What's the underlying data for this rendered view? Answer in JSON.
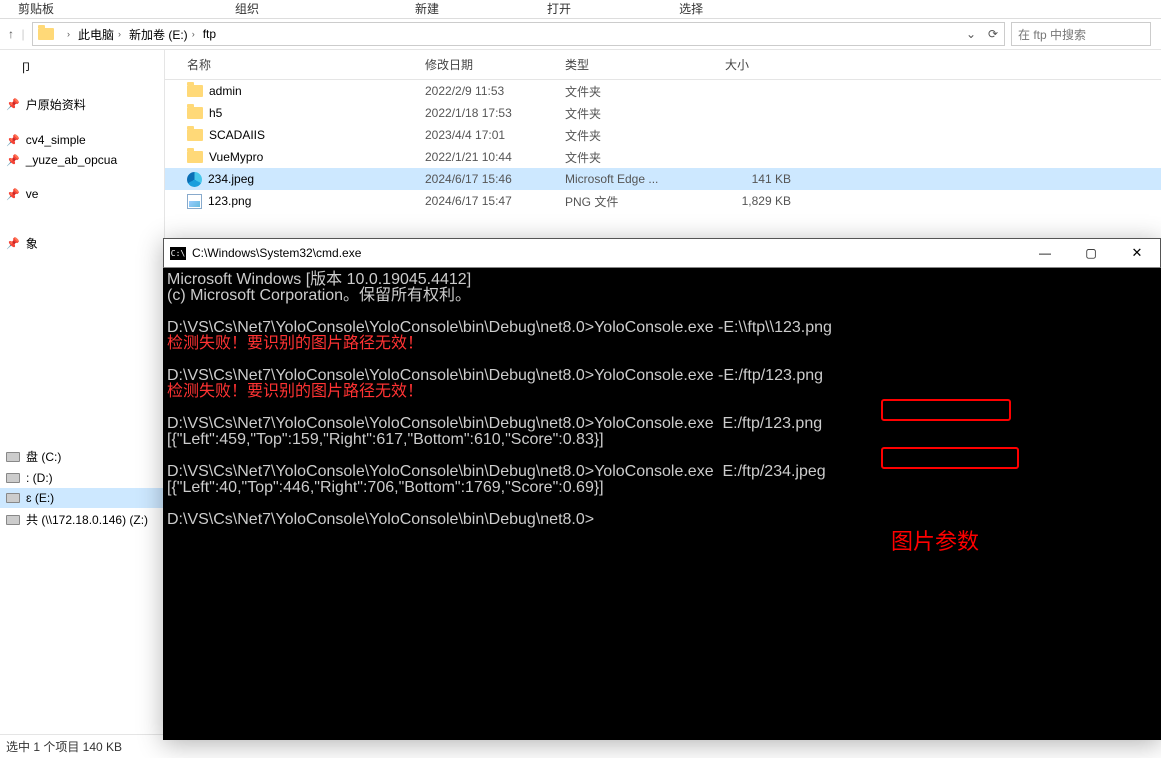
{
  "ribbon": {
    "t1": "剪贴板",
    "t2": "组织",
    "t3": "新建",
    "t4": "打开",
    "t5": "选择"
  },
  "breadcrumb": {
    "seg1": "此电脑",
    "seg2": "新加卷 (E:)",
    "seg3": "ftp"
  },
  "search": {
    "placeholder": "在 ftp 中搜索"
  },
  "sidebar": {
    "items": [
      {
        "label": "户原始资料"
      },
      {
        "label": "cv4_simple"
      },
      {
        "label": "_yuze_ab_opcua"
      },
      {
        "label": "ve"
      },
      {
        "label": "象"
      }
    ],
    "drives": [
      {
        "label": "盘 (C:)"
      },
      {
        "label": ": (D:)"
      },
      {
        "label": "ɛ (E:)",
        "sel": true
      },
      {
        "label": "共 (\\\\172.18.0.146) (Z:)"
      }
    ],
    "partial": "卩"
  },
  "columns": {
    "name": "名称",
    "date": "修改日期",
    "type": "类型",
    "size": "大小"
  },
  "files": [
    {
      "icon": "folder",
      "name": "admin",
      "date": "2022/2/9 11:53",
      "type": "文件夹",
      "size": ""
    },
    {
      "icon": "folder",
      "name": "h5",
      "date": "2022/1/18 17:53",
      "type": "文件夹",
      "size": ""
    },
    {
      "icon": "folder",
      "name": "SCADAIIS",
      "date": "2023/4/4 17:01",
      "type": "文件夹",
      "size": ""
    },
    {
      "icon": "folder",
      "name": "VueMypro",
      "date": "2022/1/21 10:44",
      "type": "文件夹",
      "size": ""
    },
    {
      "icon": "edge",
      "name": "234.jpeg",
      "date": "2024/6/17 15:46",
      "type": "Microsoft Edge ...",
      "size": "141 KB",
      "sel": true
    },
    {
      "icon": "png",
      "name": "123.png",
      "date": "2024/6/17 15:47",
      "type": "PNG 文件",
      "size": "1,829 KB"
    }
  ],
  "status": "选中 1 个项目  140 KB",
  "cmd": {
    "title": "C:\\Windows\\System32\\cmd.exe",
    "l1": "Microsoft Windows [版本 10.0.19045.4412]",
    "l2": "(c) Microsoft Corporation。保留所有权利。",
    "l3": "D:\\VS\\Cs\\Net7\\YoloConsole\\YoloConsole\\bin\\Debug\\net8.0>YoloConsole.exe -E:\\\\ftp\\\\123.png",
    "l4": "检测失败！要识别的图片路径无效！",
    "l5": "D:\\VS\\Cs\\Net7\\YoloConsole\\YoloConsole\\bin\\Debug\\net8.0>YoloConsole.exe -E:/ftp/123.png",
    "l6": "检测失败！要识别的图片路径无效！",
    "l7": "D:\\VS\\Cs\\Net7\\YoloConsole\\YoloConsole\\bin\\Debug\\net8.0>YoloConsole.exe  E:/ftp/123.png",
    "l8": "[{\"Left\":459,\"Top\":159,\"Right\":617,\"Bottom\":610,\"Score\":0.83}]",
    "l9": "D:\\VS\\Cs\\Net7\\YoloConsole\\YoloConsole\\bin\\Debug\\net8.0>YoloConsole.exe  E:/ftp/234.jpeg",
    "l10": "[{\"Left\":40,\"Top\":446,\"Right\":706,\"Bottom\":1769,\"Score\":0.69}]",
    "l11": "D:\\VS\\Cs\\Net7\\YoloConsole\\YoloConsole\\bin\\Debug\\net8.0>",
    "annotation": "图片参数"
  }
}
